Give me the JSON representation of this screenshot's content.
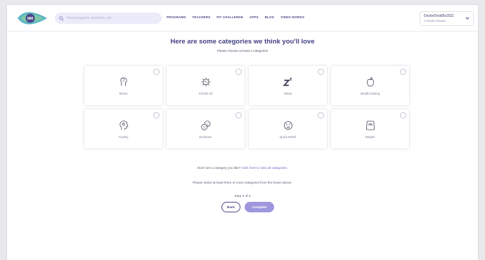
{
  "header": {
    "search_placeholder": "Find programs, teachers, etc.",
    "nav": [
      "PROGRAMS",
      "TEACHERS",
      "FIT CHALLENGE",
      "APPS",
      "BLOG",
      "VIDEO WORKS"
    ],
    "user": {
      "name": "DoctorDodd5x2021",
      "minutes": "0 Mindful Minutes"
    }
  },
  "main": {
    "title": "Here are some categories we think you'll love",
    "subtitle": "Please choose at least 3 categories",
    "categories": [
      {
        "label": "Stress",
        "icon": "brain-hand-icon"
      },
      {
        "label": "COVID-19",
        "icon": "virus-icon"
      },
      {
        "label": "Sleep",
        "icon": "zzz-icon"
      },
      {
        "label": "Mindful Eating",
        "icon": "apple-icon"
      },
      {
        "label": "Anxiety",
        "icon": "head-spiral-icon"
      },
      {
        "label": "Emotions",
        "icon": "emotion-faces-icon"
      },
      {
        "label": "Quick Relief",
        "icon": "worried-face-icon"
      },
      {
        "label": "Weight",
        "icon": "scale-icon"
      }
    ],
    "hint_text": "Don't see a category you like?",
    "hint_link": "Click here to view all categories.",
    "warning": "Please select at least three or more categories from the boxes above.",
    "step": "Step 3 of 3",
    "back_label": "Back",
    "complete_label": "Complete"
  },
  "colors": {
    "brand": "#433e85",
    "accent": "#9e97dd",
    "search_bg": "#ecebfa"
  }
}
